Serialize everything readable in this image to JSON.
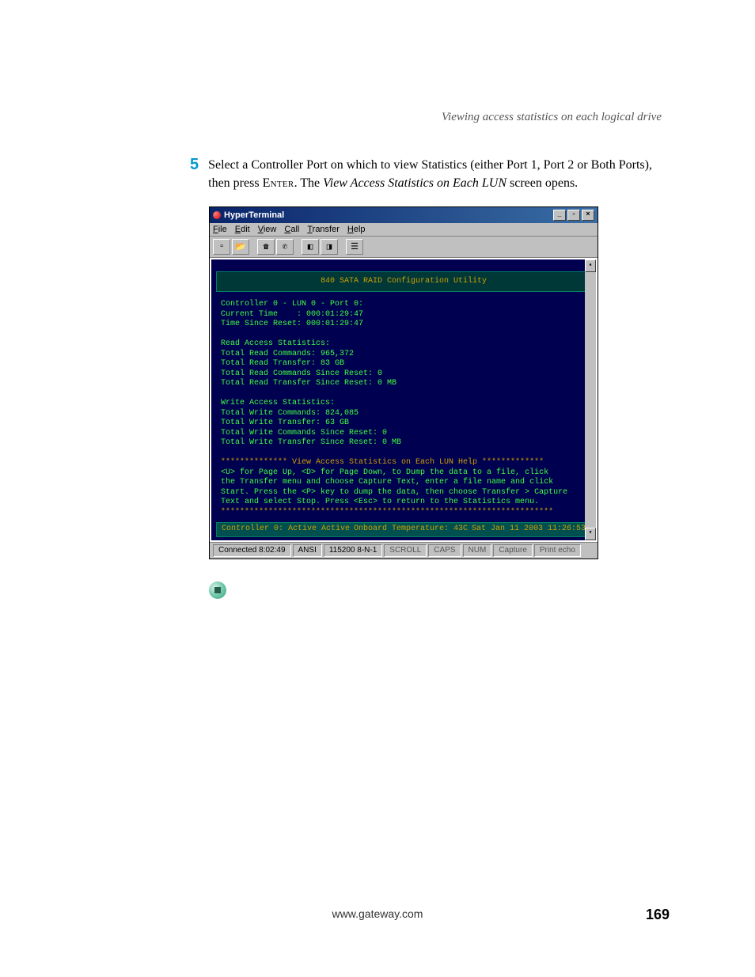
{
  "header": {
    "text": "Viewing access statistics on each logical drive"
  },
  "step": {
    "number": "5",
    "prefix": "Select a Controller Port on which to view Statistics (either Port 1, Port 2 or Both Ports), then press ",
    "key": "Enter",
    "mid": ". The ",
    "italic": "View Access Statistics on Each LUN",
    "suffix": " screen opens."
  },
  "screenshot": {
    "titlebar": {
      "title": "HyperTerminal",
      "buttons": [
        "_",
        "▫",
        "×"
      ]
    },
    "menubar": [
      "File",
      "Edit",
      "View",
      "Call",
      "Transfer",
      "Help"
    ],
    "terminal": {
      "title": "840 SATA RAID Configuration Utility",
      "lines": [
        "Controller 0 - LUN 0 - Port 0:",
        "Current Time    : 000:01:29:47",
        "Time Since Reset: 000:01:29:47",
        "",
        "Read Access Statistics:",
        "Total Read Commands: 965,372",
        "Total Read Transfer: 83 GB",
        "Total Read Commands Since Reset: 0",
        "Total Read Transfer Since Reset: 0 MB",
        "",
        "Write Access Statistics:",
        "Total Write Commands: 824,085",
        "Total Write Transfer: 63 GB",
        "Total Write Commands Since Reset: 0",
        "Total Write Transfer Since Reset: 0 MB"
      ],
      "help_title": "************** View Access Statistics on Each LUN Help *************",
      "help_lines": [
        "<U> for Page Up, <D> for Page Down, to Dump the data to a file, click",
        "the Transfer menu and choose Capture Text, enter a file name and click",
        "Start. Press the <P> key to dump the data, then choose Transfer > Capture",
        "Text and select Stop. Press <Esc> to return to the Statistics menu."
      ],
      "help_footer": "**********************************************************************",
      "status": {
        "left": "Controller 0:  Active Active",
        "center": "Onboard Temperature: 43C",
        "right": "Sat Jan 11 2003  11:26:53"
      }
    },
    "statusbar": {
      "cells": [
        "Connected 8:02:49",
        "ANSI",
        "115200 8-N-1",
        "SCROLL",
        "CAPS",
        "NUM",
        "Capture",
        "Print echo"
      ]
    }
  },
  "footer": {
    "url": "www.gateway.com",
    "page": "169"
  }
}
